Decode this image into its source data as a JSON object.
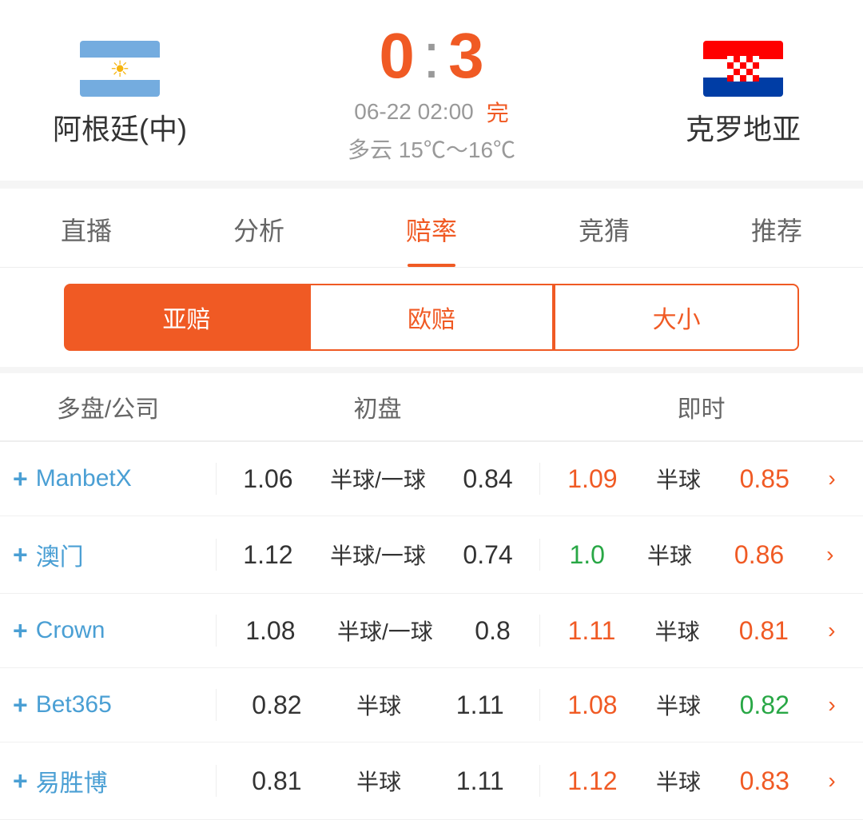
{
  "match": {
    "home_team": "阿根廷(中)",
    "away_team": "克罗地亚",
    "score_home": "0",
    "score_away": "3",
    "score_colon": ":",
    "date": "06-22 02:00",
    "status": "完",
    "weather": "多云  15℃～16℃"
  },
  "tabs": [
    {
      "label": "直播",
      "active": false
    },
    {
      "label": "分析",
      "active": false
    },
    {
      "label": "赔率",
      "active": true
    },
    {
      "label": "竞猜",
      "active": false
    },
    {
      "label": "推荐",
      "active": false
    }
  ],
  "sub_tabs": [
    {
      "label": "亚赔",
      "active": true
    },
    {
      "label": "欧赔",
      "active": false
    },
    {
      "label": "大小",
      "active": false
    }
  ],
  "table_headers": {
    "company": "多盘/公司",
    "initial": "初盘",
    "live": "即时"
  },
  "odds_rows": [
    {
      "company": "ManbetX",
      "initial_home": "1.06",
      "initial_handicap": "半球/一球",
      "initial_away": "0.84",
      "live_home": "1.09",
      "live_home_color": "orange",
      "live_handicap": "半球",
      "live_away": "0.85",
      "live_away_color": "orange"
    },
    {
      "company": "澳门",
      "initial_home": "1.12",
      "initial_handicap": "半球/一球",
      "initial_away": "0.74",
      "live_home": "1.0",
      "live_home_color": "green",
      "live_handicap": "半球",
      "live_away": "0.86",
      "live_away_color": "orange"
    },
    {
      "company": "Crown",
      "initial_home": "1.08",
      "initial_handicap": "半球/一球",
      "initial_away": "0.8",
      "live_home": "1.11",
      "live_home_color": "orange",
      "live_handicap": "半球",
      "live_away": "0.81",
      "live_away_color": "orange"
    },
    {
      "company": "Bet365",
      "initial_home": "0.82",
      "initial_handicap": "半球",
      "initial_away": "1.11",
      "live_home": "1.08",
      "live_home_color": "orange",
      "live_handicap": "半球",
      "live_away": "0.82",
      "live_away_color": "green"
    },
    {
      "company": "易胜博",
      "initial_home": "0.81",
      "initial_handicap": "半球",
      "initial_away": "1.11",
      "live_home": "1.12",
      "live_home_color": "orange",
      "live_handicap": "半球",
      "live_away": "0.83",
      "live_away_color": "orange"
    }
  ]
}
